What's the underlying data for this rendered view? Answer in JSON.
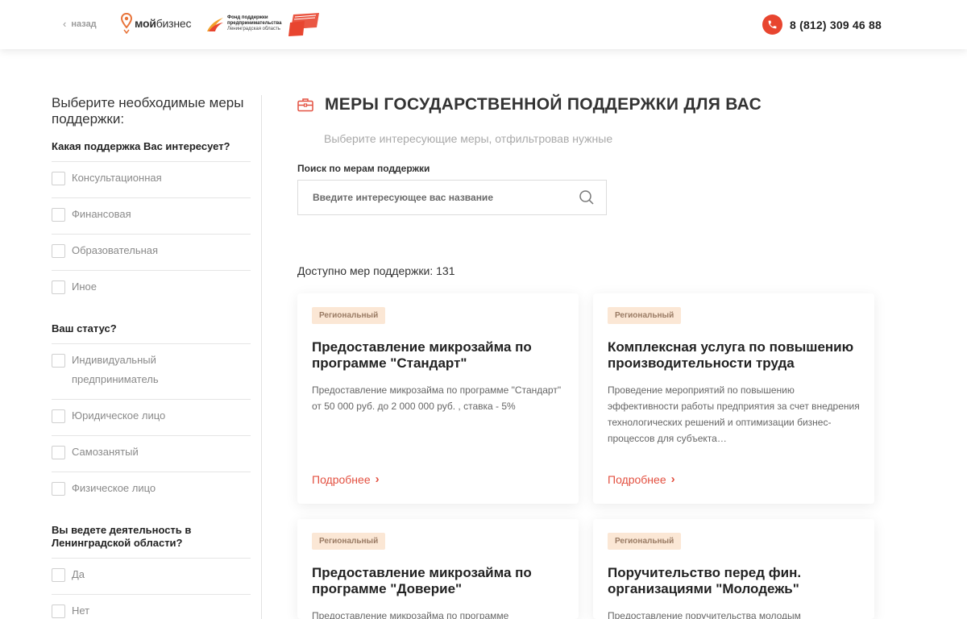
{
  "header": {
    "back_label": "назад",
    "logo_text_bold": "мой",
    "logo_text_rest": "бизнес",
    "fond_line1": "Фонд поддержки",
    "fond_line2": "предпринимательства",
    "fond_line3": "Ленинградская область",
    "phone": "8 (812) 309 46 88",
    "accent_color": "#e8452f"
  },
  "sidebar": {
    "title": "Выберите необходимые меры поддержки:",
    "groups": [
      {
        "question": "Какая поддержка Вас интересует?",
        "options": [
          "Консультационная",
          "Финансовая",
          "Образовательная",
          "Иное"
        ]
      },
      {
        "question": "Ваш статус?",
        "options": [
          "Индивидуальный предприниматель",
          "Юридическое лицо",
          "Самозанятый",
          "Физическое лицо"
        ]
      },
      {
        "question": "Вы ведете деятельность в Ленинградской области?",
        "options": [
          "Да",
          "Нет"
        ]
      }
    ]
  },
  "main": {
    "title": "МЕРЫ ГОСУДАРСТВЕННОЙ ПОДДЕРЖКИ ДЛЯ ВАС",
    "subtitle": "Выберите интересующие меры, отфильтровав нужные",
    "search_label": "Поиск по мерам поддержки",
    "search_placeholder": "Введите интересующее вас название",
    "count_label": "Доступно мер поддержки: 131",
    "more_label": "Подробнее",
    "cards": [
      {
        "badge": "Региональный",
        "title": "Предоставление микрозайма по программе \"Стандарт\"",
        "desc": "Предоставление микрозайма по программе \"Стандарт\" от 50 000 руб. до 2 000 000 руб. , ставка - 5%"
      },
      {
        "badge": "Региональный",
        "title": "Комплексная услуга по повышению производительности труда",
        "desc": "Проведение мероприятий по повышению эффективности работы предприятия за счет внедрения технологических решений и оптимизации бизнес-процессов для субъекта…"
      },
      {
        "badge": "Региональный",
        "title": "Предоставление микрозайма по программе \"Доверие\"",
        "desc": "Предоставление микрозайма по программе"
      },
      {
        "badge": "Региональный",
        "title": "Поручительство перед фин. организациями \"Молодежь\"",
        "desc": "Предоставление поручительства молодым"
      }
    ]
  }
}
